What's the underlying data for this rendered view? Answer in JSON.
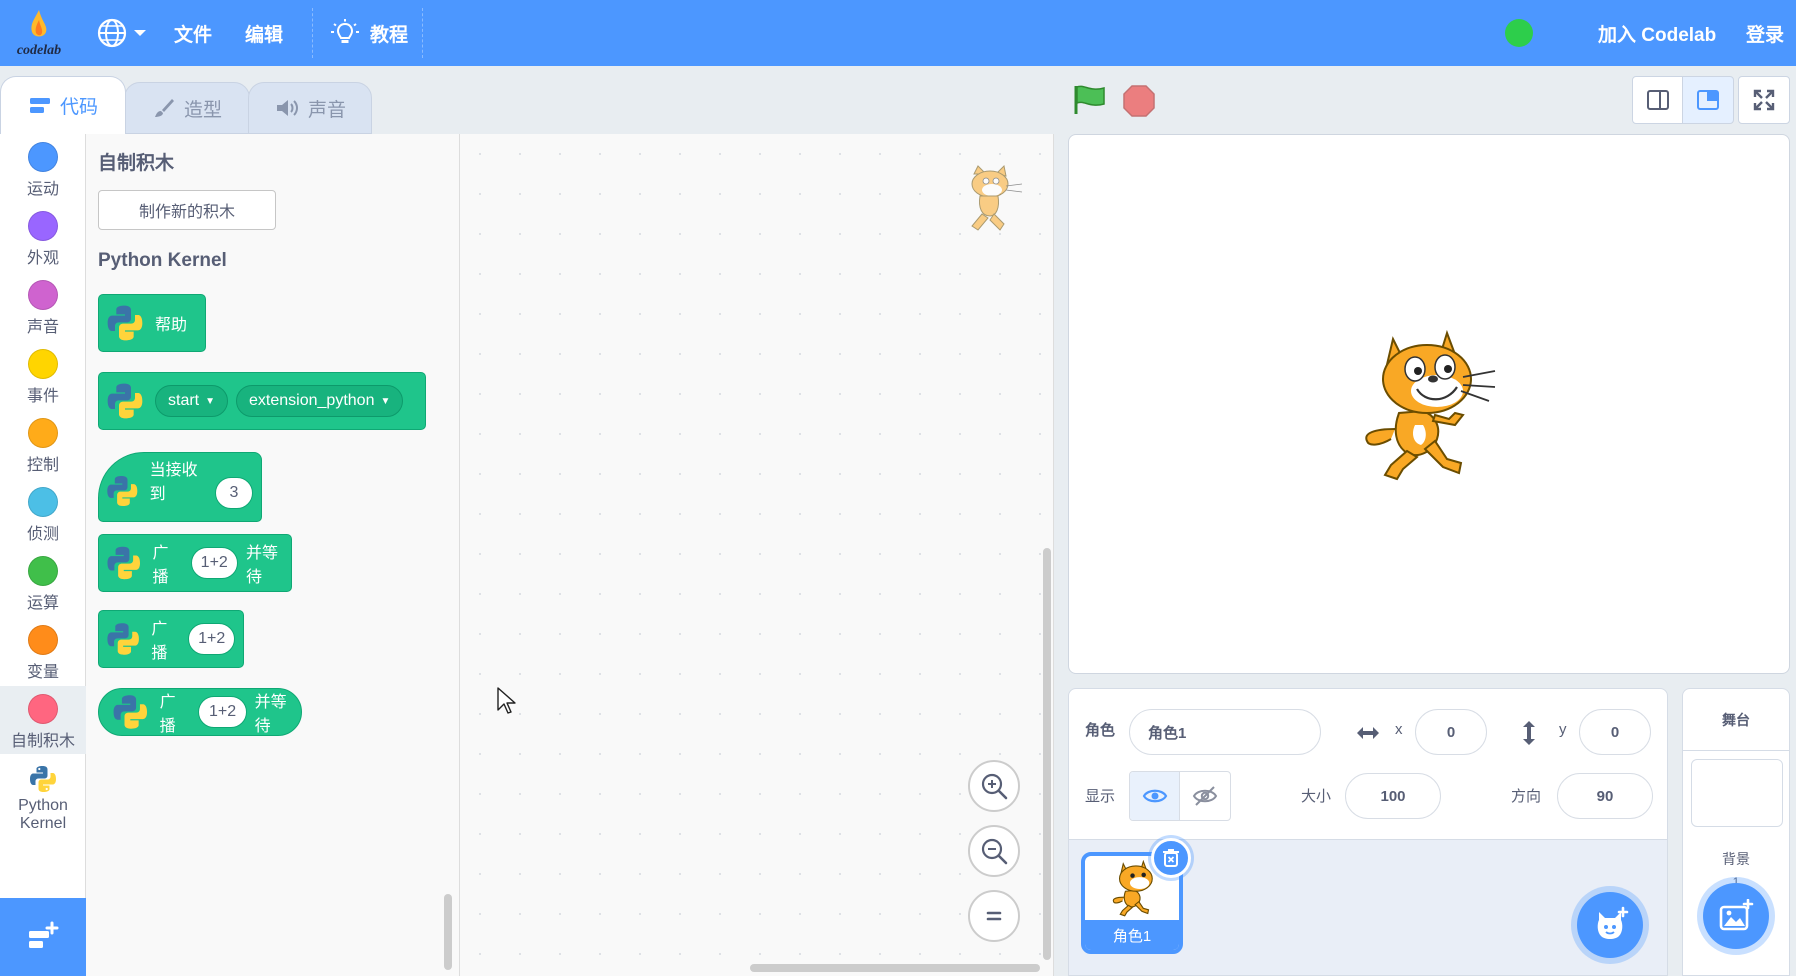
{
  "menu": {
    "logo_text": "codelab",
    "file": "文件",
    "edit": "编辑",
    "tutorials": "教程",
    "join": "加入 Codelab",
    "login": "登录"
  },
  "tabs": {
    "code": "代码",
    "costumes": "造型",
    "sounds": "声音"
  },
  "categories": [
    {
      "label": "运动",
      "color": "#4c97ff"
    },
    {
      "label": "外观",
      "color": "#9966ff"
    },
    {
      "label": "声音",
      "color": "#cf63cf"
    },
    {
      "label": "事件",
      "color": "#ffd500"
    },
    {
      "label": "控制",
      "color": "#ffab19"
    },
    {
      "label": "侦测",
      "color": "#4cbfe6"
    },
    {
      "label": "运算",
      "color": "#40bf4a"
    },
    {
      "label": "变量",
      "color": "#ff8c1a"
    },
    {
      "label": "自制积木",
      "color": "#ff6680"
    },
    {
      "label_line1": "Python",
      "label_line2": "Kernel"
    }
  ],
  "palette": {
    "my_blocks_heading": "自制积木",
    "make_block_button": "制作新的积木",
    "python_heading": "Python Kernel",
    "blocks": [
      {
        "text": "帮助"
      },
      {
        "dropdown1": "start",
        "dropdown2": "extension_python"
      },
      {
        "text": "当接收到",
        "value": "3"
      },
      {
        "text": "广播",
        "value": "1+2",
        "suffix": "并等待"
      },
      {
        "text": "广播",
        "value": "1+2"
      },
      {
        "text": "广播",
        "value": "1+2",
        "suffix": "并等待"
      }
    ]
  },
  "sprite_info": {
    "sprite_label": "角色",
    "sprite_name": "角色1",
    "x_label": "x",
    "x_value": "0",
    "y_label": "y",
    "y_value": "0",
    "show_label": "显示",
    "size_label": "大小",
    "size_value": "100",
    "direction_label": "方向",
    "direction_value": "90"
  },
  "sprite_list": [
    {
      "name": "角色1"
    }
  ],
  "stage_pane": {
    "title": "舞台",
    "backdrops_label": "背景",
    "backdrops_count": "1"
  },
  "colors": {
    "accent": "#4c97ff",
    "python_green": "#1fc58b",
    "status_green": "#2dce4b",
    "stop_red": "#ec5959"
  }
}
